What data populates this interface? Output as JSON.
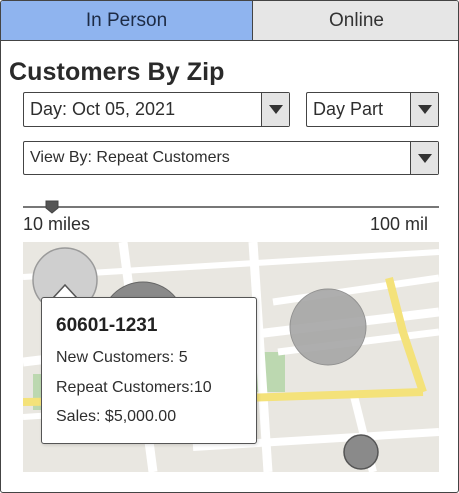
{
  "tabs": [
    {
      "label": "In Person",
      "active": true
    },
    {
      "label": "Online",
      "active": false
    }
  ],
  "page_title": "Customers By Zip",
  "filters": {
    "day": "Day: Oct 05, 2021",
    "day_part": "Day Part",
    "view_by": "View By: Repeat Customers"
  },
  "distance_slider": {
    "min_label": "10 miles",
    "max_label": "100 mil",
    "value_fraction": 0.07
  },
  "popup": {
    "zip": "60601-1231",
    "new_customers": "New Customers: 5",
    "repeat_customers": "Repeat Customers:10",
    "sales": "Sales: $5,000.00"
  },
  "colors": {
    "active_tab": "#8fb4ef",
    "inactive_tab": "#e6e6e6",
    "map_background": "#e9e7e1",
    "road_major": "#f4e27a",
    "road_minor": "#ffffff",
    "park": "#bcd8b0",
    "marker_dark": "#8a8a8a",
    "marker_light": "#cfcfcf"
  },
  "icons": {
    "dropdown_arrow": "chevron-down-icon",
    "slider_thumb": "slider-thumb"
  }
}
